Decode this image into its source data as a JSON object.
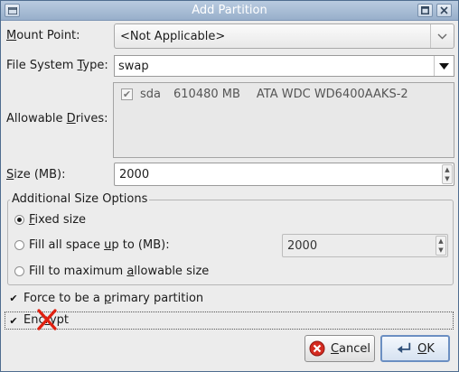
{
  "window": {
    "title": "Add Partition"
  },
  "mount_point": {
    "label_pre": "",
    "label_u": "M",
    "label_post": "ount Point:",
    "value": "<Not Applicable>"
  },
  "fs_type": {
    "label_pre": "File System ",
    "label_u": "T",
    "label_post": "ype:",
    "value": "swap"
  },
  "drives": {
    "label_pre": "Allowable ",
    "label_u": "D",
    "label_post": "rives:",
    "rows": [
      {
        "checked": true,
        "name": "sda",
        "size": "610480 MB",
        "model": "ATA WDC WD6400AAKS-2"
      }
    ]
  },
  "size": {
    "label_pre": "",
    "label_u": "S",
    "label_post": "ize (MB):",
    "value": "2000"
  },
  "size_options": {
    "legend": "Additional Size Options",
    "fixed": {
      "pre": "",
      "u": "F",
      "post": "ixed size",
      "selected": true
    },
    "fill_up_to": {
      "pre": "Fill all space ",
      "u": "u",
      "post": "p to (MB):",
      "selected": false,
      "value": "2000"
    },
    "fill_max": {
      "pre": "Fill to maximum ",
      "u": "a",
      "post": "llowable size",
      "selected": false
    }
  },
  "primary": {
    "pre": "Force to be a ",
    "u": "p",
    "post": "rimary partition",
    "checked": true
  },
  "encrypt": {
    "pre": "Enc",
    "u": "r",
    "post": "ypt",
    "checked": true
  },
  "buttons": {
    "cancel": {
      "u": "C",
      "post": "ancel"
    },
    "ok": {
      "u": "O",
      "post": "K"
    }
  },
  "colors": {
    "titlebar": "#98afcb",
    "default_button_border": "#6b8fc2",
    "cancel_icon": "#d42b20",
    "cursor_x": "#e02010"
  },
  "icons": {
    "window_menu": "window-menu-icon",
    "maximize": "maximize-icon",
    "close": "close-icon",
    "combo_arrow": "chevron-down-icon",
    "dropdown_arrow": "triangle-down-icon",
    "cancel": "cancel-icon",
    "ok": "ok-arrow-icon",
    "cursor": "x-cursor-icon"
  }
}
